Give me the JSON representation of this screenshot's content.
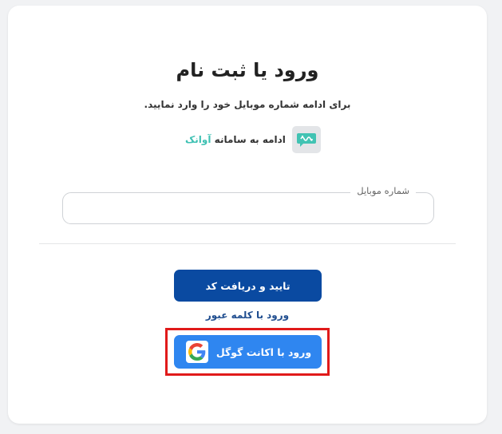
{
  "auth": {
    "title": "ورود یا ثبت نام",
    "subtitle": "برای ادامه شماره موبایل خود را وارد نمایید.",
    "provider_prefix": "ادامه به سامانه ",
    "provider_name": "آوانک",
    "provider_logo_icon": "chat-bubble-logo-icon",
    "phone_label": "شماره موبایل",
    "phone_value": "",
    "submit_label": "تایید و دریافت کد",
    "password_link": "ورود با کلمه عبور",
    "google_label": "ورود با اکانت گوگل",
    "google_icon": "google-g-icon"
  },
  "colors": {
    "primary": "#0a4aa1",
    "google_button": "#2f86f0",
    "link": "#1f4d8f",
    "provider_accent": "#3fc1b3",
    "highlight": "#e01a1a"
  }
}
